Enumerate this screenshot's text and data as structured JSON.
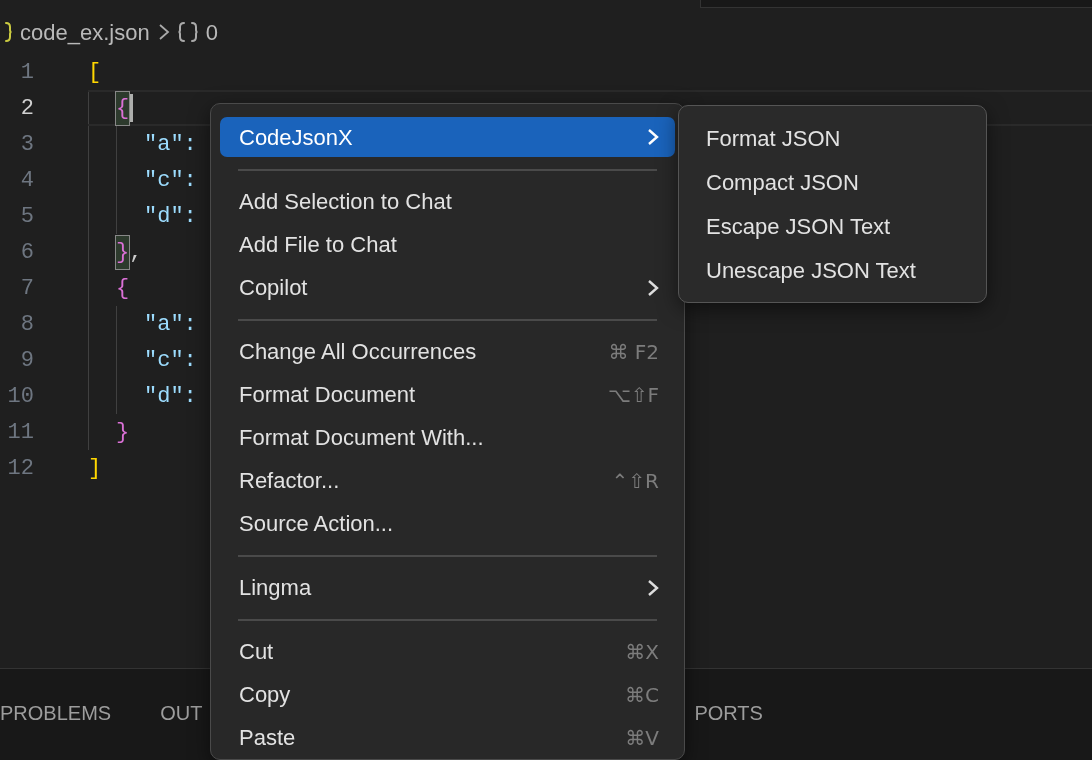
{
  "breadcrumb": {
    "file": "code_ex.json",
    "symbol": "0"
  },
  "code": [
    {
      "number": "1",
      "text": "[",
      "kind": "bracket",
      "current": false,
      "matched": false,
      "children": [
        {
          "number": "2",
          "text": "{",
          "kind": "bracket",
          "current": true,
          "matched": true,
          "children": [
            {
              "number": "3",
              "text": "\"a\":",
              "kind": "key",
              "current": false,
              "matched": false
            },
            {
              "number": "4",
              "text": "\"c\":",
              "kind": "key",
              "current": false,
              "matched": false
            },
            {
              "number": "5",
              "text": "\"d\":",
              "kind": "key",
              "current": false,
              "matched": false
            }
          ]
        },
        {
          "number": "6",
          "text": "}",
          "suffix": ",",
          "kind": "bracket",
          "current": false,
          "matched": true
        },
        {
          "number": "7",
          "text": "{",
          "kind": "bracket",
          "current": false,
          "matched": false,
          "children": [
            {
              "number": "8",
              "text": "\"a\":",
              "kind": "key",
              "current": false,
              "matched": false
            },
            {
              "number": "9",
              "text": "\"c\":",
              "kind": "key",
              "current": false,
              "matched": false
            },
            {
              "number": "10",
              "text": "\"d\":",
              "kind": "key",
              "current": false,
              "matched": false
            }
          ]
        },
        {
          "number": "11",
          "text": "}",
          "kind": "bracket",
          "current": false,
          "matched": false
        }
      ]
    },
    {
      "number": "12",
      "text": "]",
      "kind": "bracket",
      "current": false,
      "matched": false
    }
  ],
  "panel_tabs": [
    "PROBLEMS",
    "OUT",
    "PORTS"
  ],
  "context_menu": [
    {
      "kind": "item",
      "label": "CodeJsonX",
      "selected": true,
      "submenu": true
    },
    {
      "kind": "separator"
    },
    {
      "kind": "item",
      "label": "Add Selection to Chat",
      "selected": false,
      "submenu": false
    },
    {
      "kind": "item",
      "label": "Add File to Chat",
      "selected": false,
      "submenu": false
    },
    {
      "kind": "item",
      "label": "Copilot",
      "selected": false,
      "submenu": true
    },
    {
      "kind": "separator"
    },
    {
      "kind": "item",
      "label": "Change All Occurrences",
      "shortcut": "⌘ F2",
      "selected": false,
      "submenu": false
    },
    {
      "kind": "item",
      "label": "Format Document",
      "shortcut": "⌥⇧F",
      "selected": false,
      "submenu": false
    },
    {
      "kind": "item",
      "label": "Format Document With...",
      "selected": false,
      "submenu": false
    },
    {
      "kind": "item",
      "label": "Refactor...",
      "shortcut": "⌃⇧R",
      "selected": false,
      "submenu": false
    },
    {
      "kind": "item",
      "label": "Source Action...",
      "selected": false,
      "submenu": false
    },
    {
      "kind": "separator"
    },
    {
      "kind": "item",
      "label": "Lingma",
      "selected": false,
      "submenu": true
    },
    {
      "kind": "separator"
    },
    {
      "kind": "item",
      "label": "Cut",
      "shortcut": "⌘X",
      "selected": false,
      "submenu": false
    },
    {
      "kind": "item",
      "label": "Copy",
      "shortcut": "⌘C",
      "selected": false,
      "submenu": false
    },
    {
      "kind": "item",
      "label": "Paste",
      "shortcut": "⌘V",
      "selected": false,
      "submenu": false
    }
  ],
  "submenu": [
    "Format JSON",
    "Compact JSON",
    "Escape JSON Text",
    "Unescape JSON Text"
  ]
}
